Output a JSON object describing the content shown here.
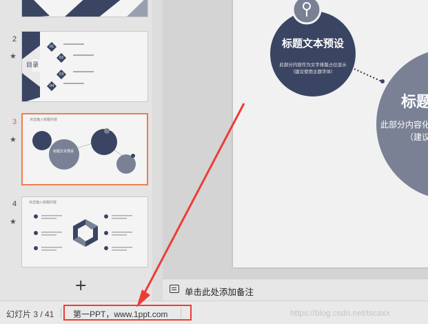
{
  "thumbnails": [
    {
      "number": "2",
      "title": "目录",
      "items": [
        "01",
        "02",
        "03",
        "04"
      ]
    },
    {
      "number": "3",
      "title": "点击输入标题内容",
      "circle_label": "标题文本预设"
    },
    {
      "number": "4",
      "title": "点击输入标题内容"
    }
  ],
  "thumb_panel": {
    "add_label": "+"
  },
  "slide": {
    "circle1_title": "标题文本预设",
    "circle1_body_line1": "此部分内容作为文字排版占位显示",
    "circle1_body_line2": "（建议使用主题字体）",
    "circle2_title": "标题",
    "circle2_body_line1": "此部分内容化",
    "circle2_body_line2": "（建议"
  },
  "notes": {
    "placeholder": "单击此处添加备注"
  },
  "status": {
    "slide_indicator": "幻灯片 3 / 41",
    "site_text": "第一PPT，www.1ppt.com",
    "watermark": "https://blog.csdn.net/tscaxx"
  },
  "colors": {
    "navy": "#3a4563",
    "slate": "#7a8195",
    "active_border": "#ee7c4c",
    "highlight_red": "#ee3b34"
  }
}
